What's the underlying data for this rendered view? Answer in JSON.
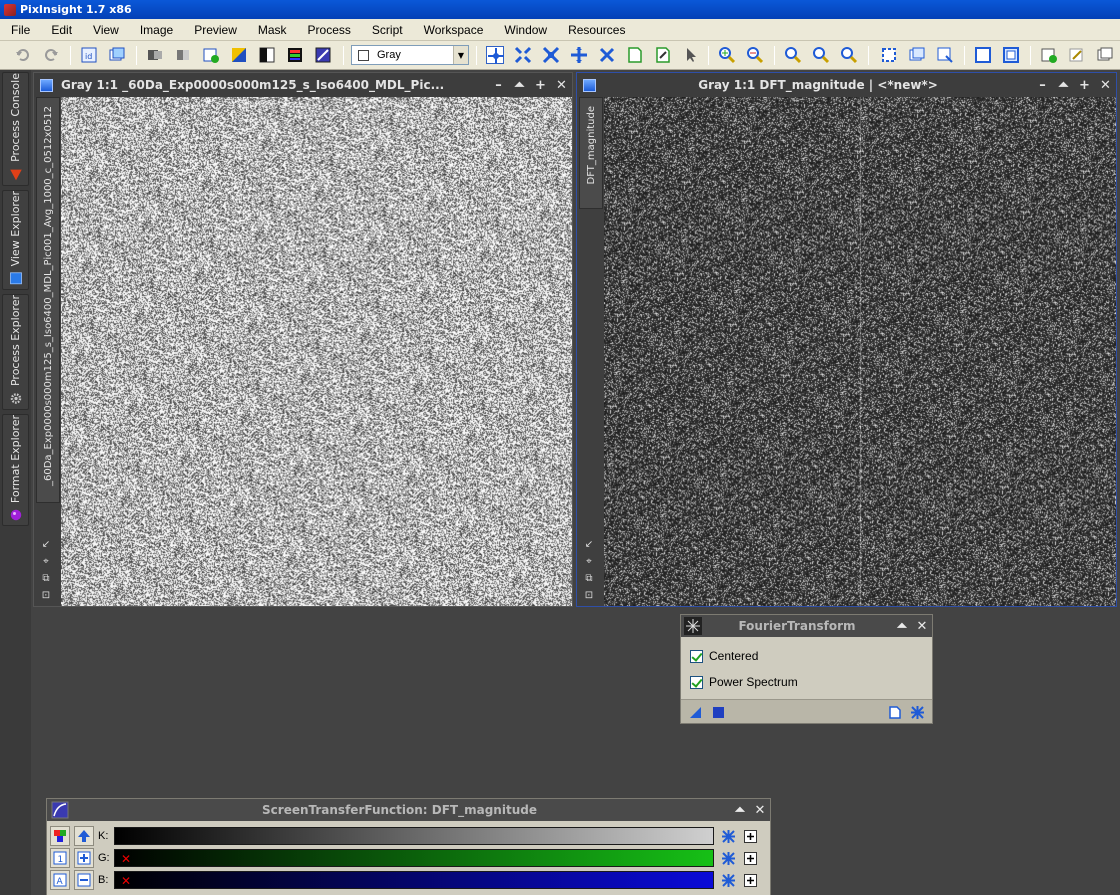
{
  "app": {
    "title": "PixInsight 1.7 x86"
  },
  "menu": [
    "File",
    "Edit",
    "View",
    "Image",
    "Preview",
    "Mask",
    "Process",
    "Script",
    "Workspace",
    "Window",
    "Resources"
  ],
  "toolbar": {
    "color_mode": "Gray"
  },
  "dock_tabs": [
    "Process Console",
    "View Explorer",
    "Process Explorer",
    "Format Explorer"
  ],
  "window_left": {
    "title": "Gray 1:1 _60Da_Exp0000s000m125_s_Iso6400_MDL_Pic...",
    "view_id": "_60Da_Exp0000s000m125_s_Iso6400_MDL_Pic001_Avg_1000_c_0512x0512"
  },
  "window_right": {
    "title": "Gray 1:1 DFT_magnitude | <*new*>",
    "view_id": "DFT_magnitude"
  },
  "fourier_dialog": {
    "title": "FourierTransform",
    "options": [
      {
        "label": "Centered",
        "checked": true
      },
      {
        "label": "Power Spectrum",
        "checked": true
      }
    ]
  },
  "stf_dialog": {
    "title": "ScreenTransferFunction: DFT_magnitude",
    "channels": [
      {
        "label": "K:",
        "color": "#d0d0d0"
      },
      {
        "label": "G:",
        "color": "#16c016"
      },
      {
        "label": "B:",
        "color": "#0a0ad8"
      }
    ]
  },
  "colors": {
    "title_blue": "#0a58d8",
    "workspace": "#434343",
    "menu_bg": "#ece9d8"
  }
}
